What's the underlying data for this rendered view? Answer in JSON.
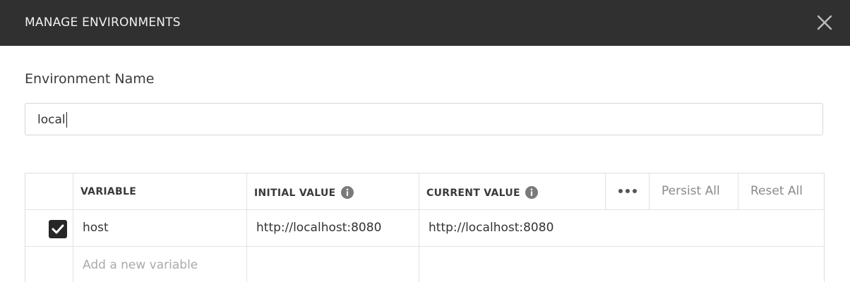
{
  "header": {
    "title": "MANAGE ENVIRONMENTS",
    "close_icon": "close-icon"
  },
  "environment": {
    "label": "Environment Name",
    "value": "local"
  },
  "table": {
    "columns": {
      "variable": "VARIABLE",
      "initial_value": "INITIAL VALUE",
      "current_value": "CURRENT VALUE"
    },
    "actions": {
      "more_icon": "more-dots-icon",
      "persist_all": "Persist All",
      "reset_all": "Reset All"
    },
    "rows": [
      {
        "enabled": true,
        "variable": "host",
        "initial_value": "http://localhost:8080",
        "current_value": "http://localhost:8080"
      }
    ],
    "new_variable_placeholder": "Add a new variable"
  },
  "colors": {
    "header_bg": "#303030",
    "header_text": "#f2f2f2",
    "border": "#e2e2e2",
    "muted_text": "#8a8a8a",
    "checkbox_bg": "#262626"
  }
}
